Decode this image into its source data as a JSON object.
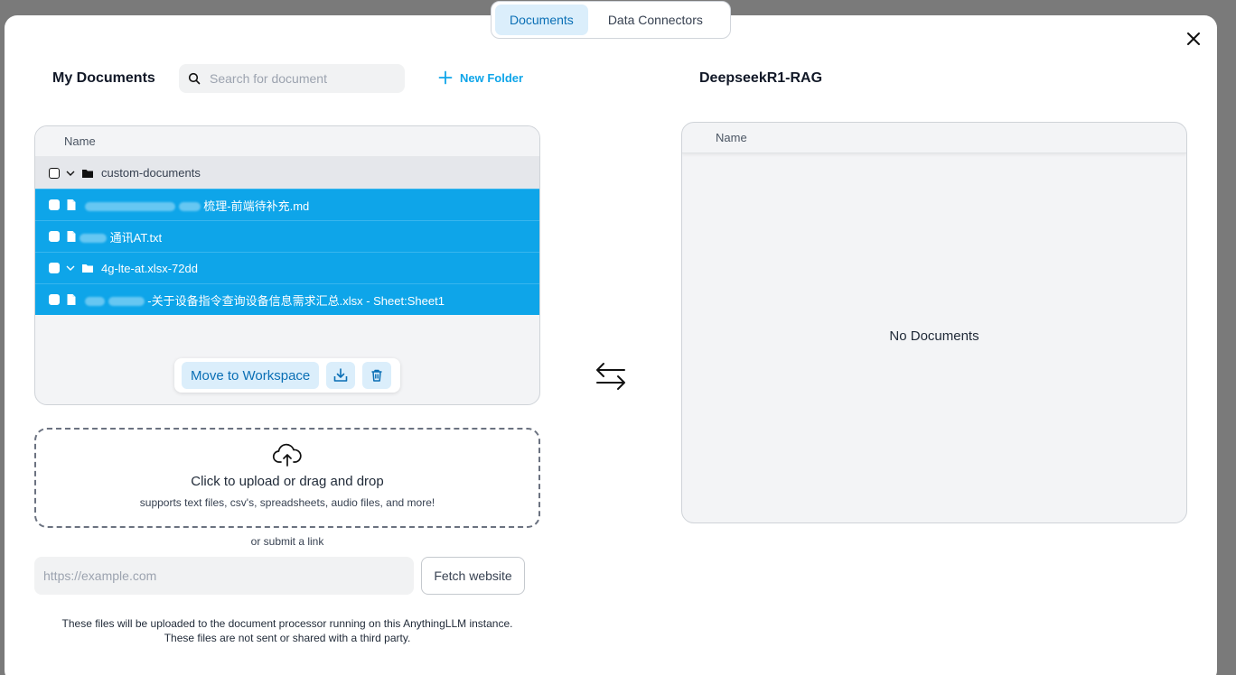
{
  "tabs": [
    {
      "label": "Documents",
      "active": true
    },
    {
      "label": "Data Connectors",
      "active": false
    }
  ],
  "my_documents": {
    "title": "My Documents",
    "search_placeholder": "Search for document",
    "new_folder_label": "New Folder",
    "column_name": "Name",
    "rows": [
      {
        "type": "folder",
        "name": "custom-documents",
        "selected": false,
        "expanded": true
      },
      {
        "type": "file",
        "name": "梳理-前端待补充.md",
        "selected": true
      },
      {
        "type": "file",
        "name": "通讯AT.txt",
        "selected": true
      },
      {
        "type": "folder",
        "name": "4g-lte-at.xlsx-72dd",
        "selected": true,
        "expanded": true
      },
      {
        "type": "file",
        "name": "-关于设备指令查询设备信息需求汇总.xlsx - Sheet:Sheet1",
        "selected": true
      }
    ],
    "actions": {
      "move_label": "Move to Workspace",
      "download_icon": "download-tray-icon",
      "delete_icon": "trash-icon"
    }
  },
  "workspace": {
    "title": "DeepseekR1-RAG",
    "column_name": "Name",
    "empty_text": "No Documents"
  },
  "upload": {
    "title": "Click to upload or drag and drop",
    "subtitle": "supports text files, csv's, spreadsheets, audio files, and more!",
    "or_link": "or submit a link",
    "url_placeholder": "https://example.com",
    "fetch_label": "Fetch website",
    "notice_line1": "These files will be uploaded to the document processor running on this AnythingLLM instance.",
    "notice_line2": "These files are not sent or shared with a third party."
  },
  "colors": {
    "accent": "#0ea5e9",
    "selected_row": "#0ea5e9",
    "tab_active_bg": "#dbeefb"
  }
}
